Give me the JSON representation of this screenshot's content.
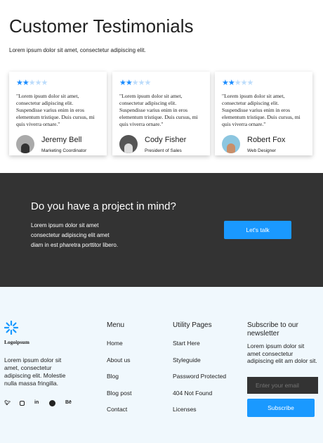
{
  "header": {
    "title": "Customer Testimonials",
    "subtitle": "Lorem ipsum dolor sit amet, consectetur adipiscing elit."
  },
  "testimonials": [
    {
      "rating": 2,
      "max_rating": 5,
      "quote": "\"Lorem ipsum dolor sit amet, consectetur adipiscing elit. Suspendisse varius enim in eros elementum tristique. Duis cursus, mi quis viverra ornare.\"",
      "name": "Jeremy Bell",
      "role": "Marketing Coordinator"
    },
    {
      "rating": 2,
      "max_rating": 5,
      "quote": "\"Lorem ipsum dolor sit amet, consectetur adipiscing elit. Suspendisse varius enim in eros elementum tristique. Duis cursus, mi quis viverra ornare.\"",
      "name": "Cody Fisher",
      "role": "President of Sales"
    },
    {
      "rating": 2,
      "max_rating": 5,
      "quote": "\"Lorem ipsum dolor sit amet, consectetur adipiscing elit. Suspendisse varius enim in eros elementum tristique. Duis cursus, mi quis viverra ornare.\"",
      "name": "Robert Fox",
      "role": "Web Designer"
    }
  ],
  "cta": {
    "title": "Do you have a project in mind?",
    "text": "Lorem ipsum dolor sit amet consectetur adipiscing elit amet diam in est pharetra porttitor libero.",
    "button": "Let's talk"
  },
  "footer": {
    "logo": "Logoipsum",
    "about": "Lorem ipsum dolor sit amet, consectetur adipiscing elit. Molestie nulla massa fringilla.",
    "social": [
      "twitter-icon",
      "instagram-icon",
      "linkedin-icon",
      "whatsapp-icon",
      "behance-icon"
    ],
    "behance_label": "Bē",
    "linkedin_label": "in",
    "menu": {
      "title": "Menu",
      "items": [
        "Home",
        "About us",
        "Blog",
        "Blog post",
        "Contact"
      ]
    },
    "utility": {
      "title": "Utility Pages",
      "items": [
        "Start Here",
        "Styleguide",
        "Password Protected",
        "404 Not Found",
        "Licenses"
      ]
    },
    "newsletter": {
      "title": "Subscribe to our newsletter",
      "text": "Lorem ipsum dolor sit amet consectetur adipiscing elit am dolor sit.",
      "placeholder": "Enter your email",
      "button": "Subscribe"
    }
  },
  "colors": {
    "accent": "#1a99ff",
    "dark": "#333333",
    "footer_bg": "#f0f8fd"
  }
}
